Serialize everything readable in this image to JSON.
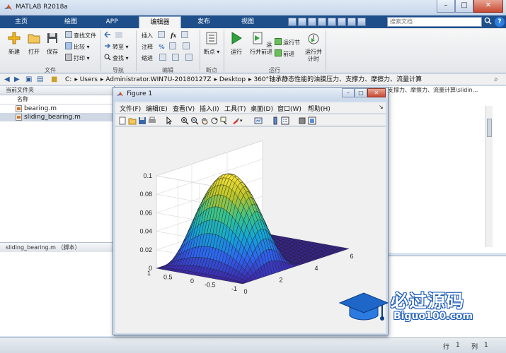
{
  "app": {
    "title": "MATLAB R2018a"
  },
  "tabs": [
    {
      "label": "主页"
    },
    {
      "label": "绘图"
    },
    {
      "label": "APP"
    },
    {
      "label": "编辑器"
    },
    {
      "label": "发布"
    },
    {
      "label": "视图"
    }
  ],
  "search": {
    "placeholder": "搜索文档",
    "help": "?"
  },
  "window_controls": {
    "minimize": "–",
    "maximize": "□",
    "close": "✕"
  },
  "ribbon": {
    "groups": [
      "文件",
      "导航",
      "编辑",
      "断点",
      "运行"
    ],
    "file": {
      "new": "新建",
      "open": "打开",
      "save": "保存",
      "find_files": "查找文件",
      "compare": "比较",
      "print": "打印"
    },
    "nav": {
      "goto": "转至",
      "find": "查找"
    },
    "edit": {
      "insert": "插入",
      "comment": "注释",
      "indent": "缩进",
      "fx": "fx"
    },
    "breakpoints": {
      "label": "断点"
    },
    "run": {
      "run": "运行",
      "run_advance": "运行并前进",
      "run_section": "运行节",
      "advance": "前进",
      "run_time": "运行并计时"
    }
  },
  "address": {
    "path": [
      "C:",
      "Users",
      "Administrator.WIN7U-20180127Z",
      "Desktop",
      "360°轴承静态性能的油膜压力、支撑力、摩擦力、流量计算"
    ]
  },
  "current_folder": {
    "title": "当前文件夹",
    "column_name": "名称",
    "files": [
      {
        "name": "bearing.m",
        "selected": false
      },
      {
        "name": "sliding_bearing.m",
        "selected": true
      }
    ],
    "details": "sliding_bearing.m （脚本）"
  },
  "editor": {
    "tab_path": "支撑力、摩擦力、流量计算\\slidin..."
  },
  "status": {
    "row_label": "行",
    "row": "1",
    "col_label": "列",
    "col": "1"
  },
  "figure": {
    "title": "Figure 1",
    "menus": [
      "文件(F)",
      "编辑(E)",
      "查看(V)",
      "插入(I)",
      "工具(T)",
      "桌面(D)",
      "窗口(W)",
      "帮助(H)"
    ],
    "window_controls": {
      "minimize": "–",
      "maximize": "□",
      "close": "✕"
    }
  },
  "chart_data": {
    "type": "surface",
    "zlim": [
      0,
      0.1
    ],
    "ylim": [
      -1,
      1
    ],
    "xlim": [
      0,
      6
    ],
    "z_ticks": [
      "0",
      "0.02",
      "0.04",
      "0.06",
      "0.08",
      "0.1"
    ],
    "y_ticks": [
      "1",
      "0.5",
      "0",
      "-0.5",
      "-1"
    ],
    "x_ticks": [
      "0",
      "2",
      "4",
      "6"
    ],
    "grid": true,
    "colormap": "parula",
    "peak_z": 0.1
  },
  "watermark": {
    "main": "必过源码",
    "sub": "Biguo100.com"
  },
  "colors": {
    "tab_bar": "#1e4f8a",
    "accent": "#2d7ee0",
    "surface_low": "#3e268a",
    "surface_high": "#f9e43a"
  }
}
